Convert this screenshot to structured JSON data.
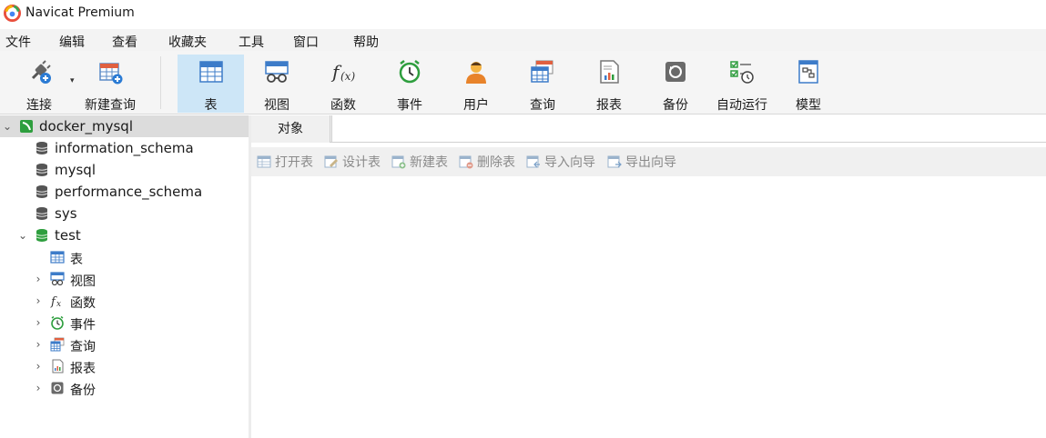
{
  "app": {
    "title": "Navicat Premium"
  },
  "menu": [
    "文件",
    "编辑",
    "查看",
    "收藏夹",
    "工具",
    "窗口",
    "帮助"
  ],
  "toolbar": {
    "connect": "连接",
    "new_query": "新建查询",
    "table": "表",
    "view": "视图",
    "function": "函数",
    "event": "事件",
    "user": "用户",
    "query": "查询",
    "report": "报表",
    "backup": "备份",
    "automation": "自动运行",
    "model": "模型"
  },
  "tree": {
    "connection": "docker_mysql",
    "databases": [
      "information_schema",
      "mysql",
      "performance_schema",
      "sys",
      "test"
    ],
    "test_children": [
      "表",
      "视图",
      "函数",
      "事件",
      "查询",
      "报表",
      "备份"
    ]
  },
  "tabs": {
    "objects": "对象"
  },
  "object_toolbar": {
    "open_table": "打开表",
    "design_table": "设计表",
    "new_table": "新建表",
    "delete_table": "删除表",
    "import_wizard": "导入向导",
    "export_wizard": "导出向导"
  },
  "colors": {
    "accent_active": "#cde6f7",
    "db_green": "#2e9e3e",
    "db_gray": "#555555"
  }
}
